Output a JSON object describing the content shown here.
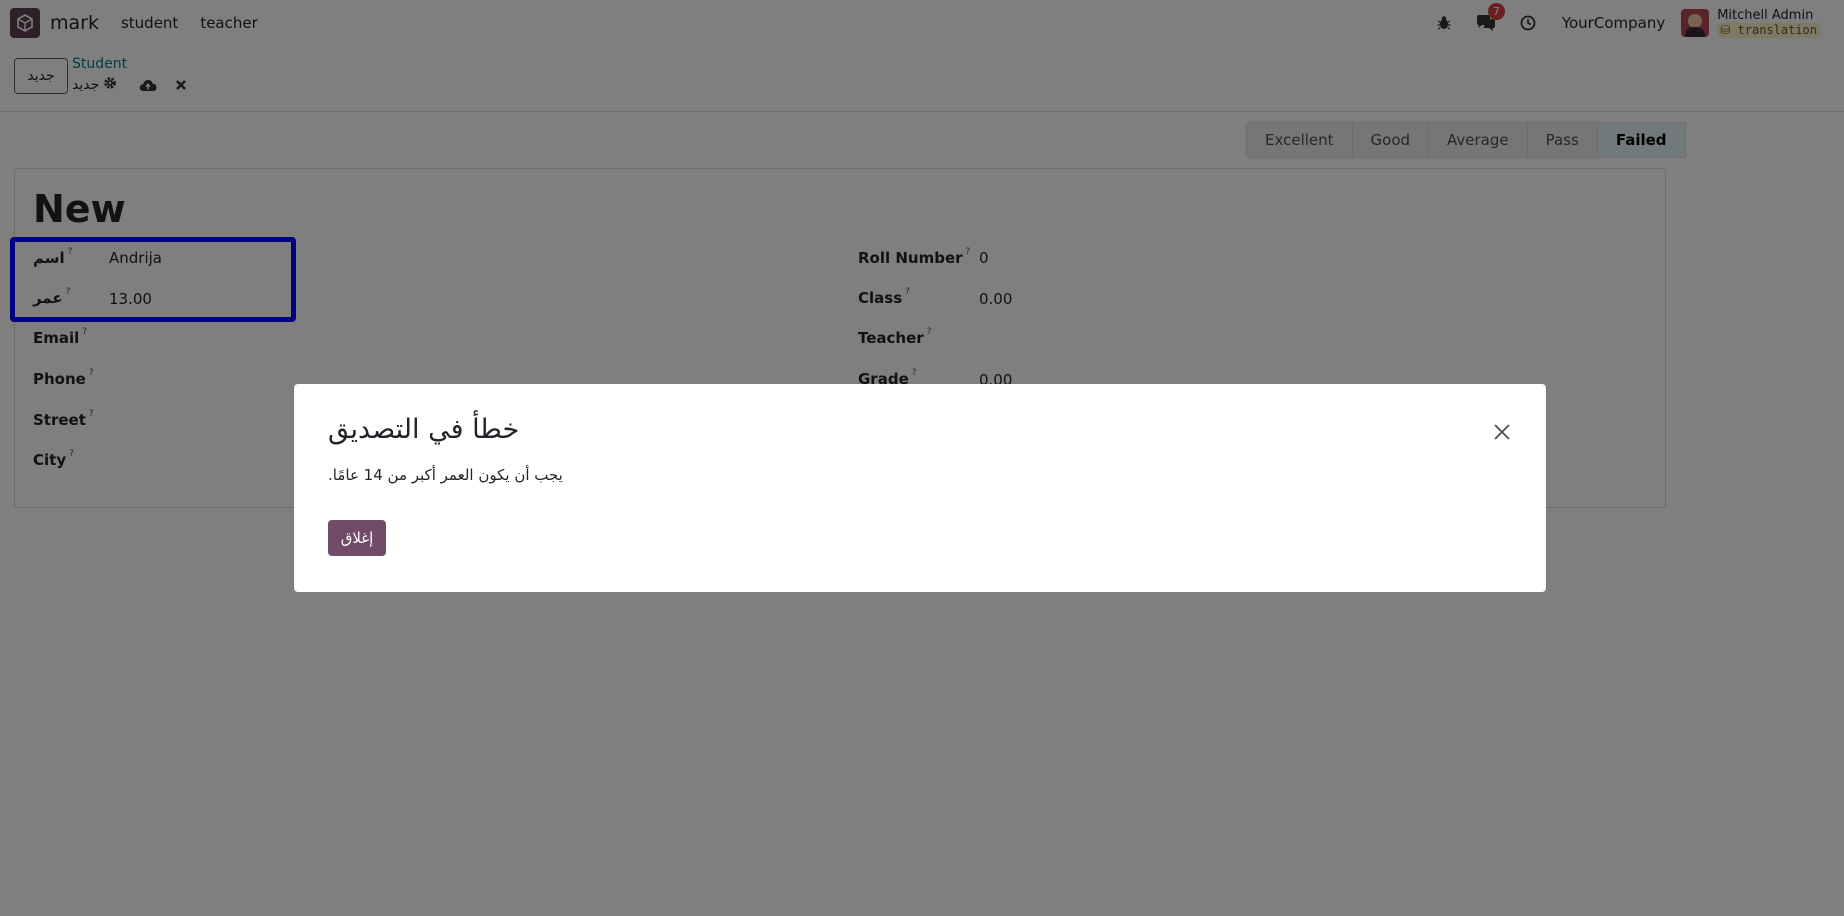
{
  "navbar": {
    "app_name": "mark",
    "menu": [
      "student",
      "teacher"
    ],
    "messages_count": "7",
    "company": "YourCompany",
    "user_name": "Mitchell Admin",
    "database": "translation"
  },
  "control_panel": {
    "new_button": "جديد",
    "breadcrumb": "Student",
    "record_name": "جديد"
  },
  "statusbar": {
    "stages": [
      "Excellent",
      "Good",
      "Average",
      "Pass",
      "Failed"
    ],
    "active_stage": "Failed"
  },
  "form": {
    "title": "New",
    "help_marker": "?",
    "left_fields": [
      {
        "label": "اسم",
        "value": "Andrija"
      },
      {
        "label": "عمر",
        "value": "13.00"
      },
      {
        "label": "Email",
        "value": ""
      },
      {
        "label": "Phone",
        "value": ""
      },
      {
        "label": "Street",
        "value": ""
      },
      {
        "label": "City",
        "value": ""
      }
    ],
    "right_fields": [
      {
        "label": "Roll Number",
        "value": "0"
      },
      {
        "label": "Class",
        "value": "0.00"
      },
      {
        "label": "Teacher",
        "value": ""
      },
      {
        "label": "Grade",
        "value": "0.00"
      }
    ]
  },
  "dialog": {
    "title": "خطأ في التصديق",
    "message": "يجب أن يكون العمر أكبر من 14 عامًا.",
    "close_button": "إغلاق"
  },
  "colors": {
    "primary": "#714b67",
    "highlight_box": "#0000ff",
    "breadcrumb": "#017e84",
    "badge": "#d23f3a"
  }
}
